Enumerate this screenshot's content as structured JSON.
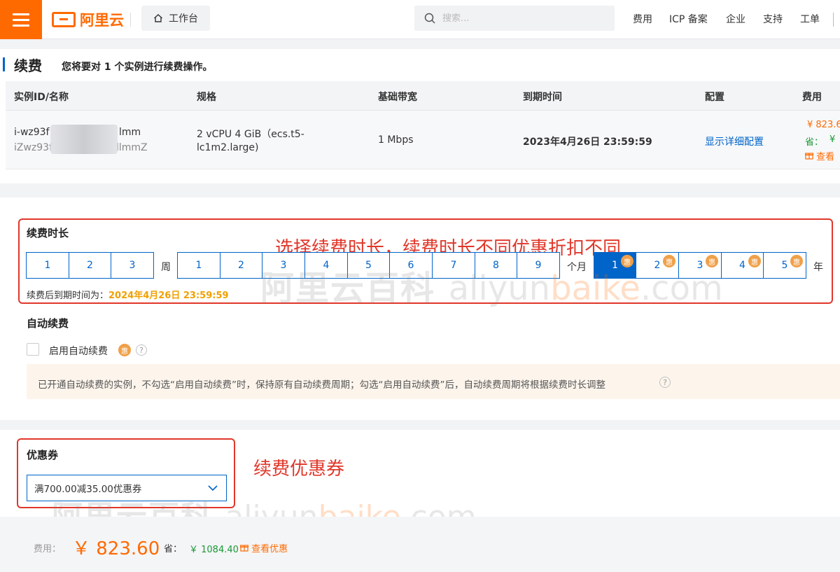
{
  "header": {
    "brand": "阿里云",
    "workbench_label": "工作台",
    "search_placeholder": "搜索...",
    "nav": [
      "费用",
      "ICP 备案",
      "企业",
      "支持",
      "工单"
    ]
  },
  "page": {
    "title": "续费",
    "description": "您将要对 1 个实例进行续费操作。"
  },
  "instance_table": {
    "columns": [
      "实例ID/名称",
      "规格",
      "基础带宽",
      "到期时间",
      "配置",
      "费用"
    ],
    "row": {
      "id_start": "i-wz93f",
      "id_end": "lmm",
      "name_start": "iZwz93f",
      "name_end": "llmmZ",
      "spec_line1": "2 vCPU 4 GiB（ecs.t5-",
      "spec_line2": "lc1m2.large)",
      "bandwidth": "1 Mbps",
      "expire": "2023年4月26日 23:59:59",
      "config_link": "显示详细配置",
      "price": "¥ 823.6",
      "save_label": "省：",
      "save_value": "¥",
      "view_label": "查看"
    }
  },
  "renew": {
    "section_title": "续费时长",
    "annotation": "选择续费时长，续费时长不同优惠折扣不同",
    "week_options": [
      "1",
      "2",
      "3"
    ],
    "week_unit": "周",
    "month_options": [
      "1",
      "2",
      "3",
      "4",
      "5",
      "6",
      "7",
      "8",
      "9"
    ],
    "month_unit": "个月",
    "year_options": [
      "1",
      "2",
      "3",
      "4",
      "5"
    ],
    "year_unit": "年",
    "selected_year": "1",
    "discount_badge": "惠",
    "expiry_label": "续费后到期时间为：",
    "expiry_value": "2024年4月26日 23:59:59"
  },
  "auto_renew": {
    "section_title": "自动续费",
    "checkbox_label": "启用自动续费",
    "badge": "惠",
    "checked": false,
    "notice": "已开通自动续费的实例，不勾选“启用自动续费”时，保持原有自动续费周期；勾选“启用自动续费”后，自动续费周期将根据续费时长调整"
  },
  "coupon": {
    "section_title": "优惠券",
    "annotation": "续费优惠券",
    "selected": "满700.00减35.00优惠券"
  },
  "watermark": {
    "cn": "阿里云百科",
    "en_gray1": "aliyun",
    "en_orange": "baike",
    "en_gray2": ".com"
  },
  "footer": {
    "fee_label": "费用：",
    "price": "￥ 823.60",
    "save_label": "省：",
    "save_value": "￥ 1084.40",
    "view_label": "查看优惠"
  },
  "colors": {
    "brand": "#ff6a00",
    "primary": "#0064c8",
    "annotation": "#e0372a",
    "save": "#1a9a36",
    "expiry_highlight": "#f0a000"
  }
}
